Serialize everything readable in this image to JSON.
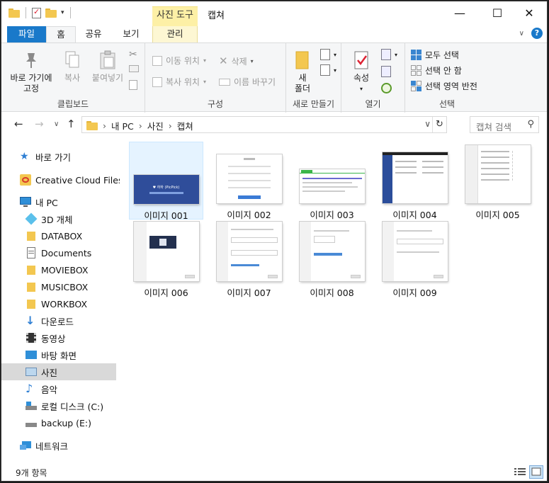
{
  "window": {
    "title": "캡쳐",
    "context_tab_header": "사진 도구",
    "controls": {
      "minimize": "—",
      "maximize": "☐",
      "close": "✕"
    }
  },
  "tabs": [
    {
      "label": "파일"
    },
    {
      "label": "홈"
    },
    {
      "label": "공유"
    },
    {
      "label": "보기"
    },
    {
      "label": "관리"
    }
  ],
  "ribbon": {
    "clipboard": {
      "label": "클립보드",
      "pin_line1": "바로 가기에",
      "pin_line2": "고정",
      "copy": "복사",
      "paste": "붙여넣기"
    },
    "organize": {
      "label": "구성",
      "move_to": "이동 위치",
      "copy_to": "복사 위치",
      "delete": "삭제",
      "rename": "이름 바꾸기"
    },
    "new": {
      "label": "새로 만들기",
      "new_folder_line1": "새",
      "new_folder_line2": "폴더"
    },
    "open": {
      "label": "열기",
      "properties": "속성"
    },
    "select": {
      "label": "선택",
      "select_all": "모두 선택",
      "select_none": "선택 안 함",
      "invert": "선택 영역 반전"
    }
  },
  "address": {
    "crumbs": [
      "내 PC",
      "사진",
      "캡쳐"
    ],
    "search_placeholder": "캡쳐 검색"
  },
  "nav": [
    {
      "label": "바로 가기",
      "icon": "star-icon"
    },
    {
      "label": "Creative Cloud Files",
      "icon": "creative-cloud-icon"
    },
    {
      "label": "내 PC",
      "icon": "pc-icon"
    },
    {
      "label": "3D 개체",
      "icon": "cube-icon"
    },
    {
      "label": "DATABOX",
      "icon": "folder-icon"
    },
    {
      "label": "Documents",
      "icon": "document-icon"
    },
    {
      "label": "MOVIEBOX",
      "icon": "folder-icon"
    },
    {
      "label": "MUSICBOX",
      "icon": "folder-icon"
    },
    {
      "label": "WORKBOX",
      "icon": "folder-icon"
    },
    {
      "label": "다운로드",
      "icon": "download-icon"
    },
    {
      "label": "동영상",
      "icon": "film-icon"
    },
    {
      "label": "바탕 화면",
      "icon": "desktop-icon"
    },
    {
      "label": "사진",
      "icon": "pictures-icon"
    },
    {
      "label": "음악",
      "icon": "music-icon"
    },
    {
      "label": "로컬 디스크 (C:)",
      "icon": "drive-c-icon"
    },
    {
      "label": "backup (E:)",
      "icon": "drive-icon"
    },
    {
      "label": "네트워크",
      "icon": "network-icon"
    }
  ],
  "files": [
    {
      "name": "이미지 001",
      "thumb_kind": "blue-banner"
    },
    {
      "name": "이미지 002",
      "thumb_kind": "form"
    },
    {
      "name": "이미지 003",
      "thumb_kind": "webpage"
    },
    {
      "name": "이미지 004",
      "thumb_kind": "dark-sidebar"
    },
    {
      "name": "이미지 005",
      "thumb_kind": "settings-list"
    },
    {
      "name": "이미지 006",
      "thumb_kind": "dialog-image"
    },
    {
      "name": "이미지 007",
      "thumb_kind": "dialog"
    },
    {
      "name": "이미지 008",
      "thumb_kind": "dialog"
    },
    {
      "name": "이미지 009",
      "thumb_kind": "dialog"
    }
  ],
  "thumb1_caption": "♥ 하하 (PicPick)",
  "status": {
    "count": "9개 항목"
  },
  "colors": {
    "accent": "#1979ca",
    "context_tab": "#fdf0a6",
    "folder": "#f3c750",
    "selected_nav": "#d9d9d9",
    "selected_item": "#e5f3ff"
  }
}
